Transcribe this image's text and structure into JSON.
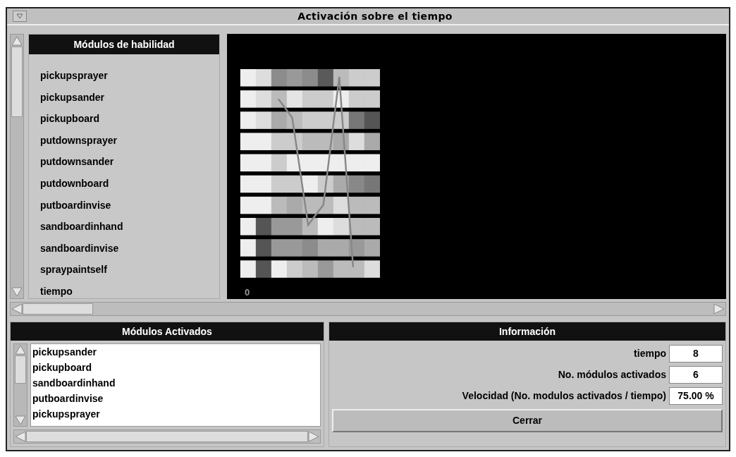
{
  "window": {
    "title": "Activación sobre el tiempo"
  },
  "skills_panel": {
    "header": "Módulos de habilidad",
    "items": [
      "pickupsprayer",
      "pickupsander",
      "pickupboard",
      "putdownsprayer",
      "putdownsander",
      "putdownboard",
      "putboardinvise",
      "sandboardinhand",
      "sandboardinvise",
      "spraypaintself",
      "tiempo"
    ]
  },
  "chart_axis_label": "0",
  "activated_panel": {
    "header": "Módulos Activados",
    "items": [
      "pickupsander",
      "pickupboard",
      "sandboardinhand",
      "putboardinvise",
      "pickupsprayer"
    ]
  },
  "info_panel": {
    "header": "Información",
    "fields": [
      {
        "label": "tiempo",
        "value": "8"
      },
      {
        "label": "No. módulos activados",
        "value": "6"
      },
      {
        "label": "Velocidad (No. modulos activados / tiempo)",
        "value": "75.00 %"
      }
    ]
  },
  "close_button": "Cerrar"
}
